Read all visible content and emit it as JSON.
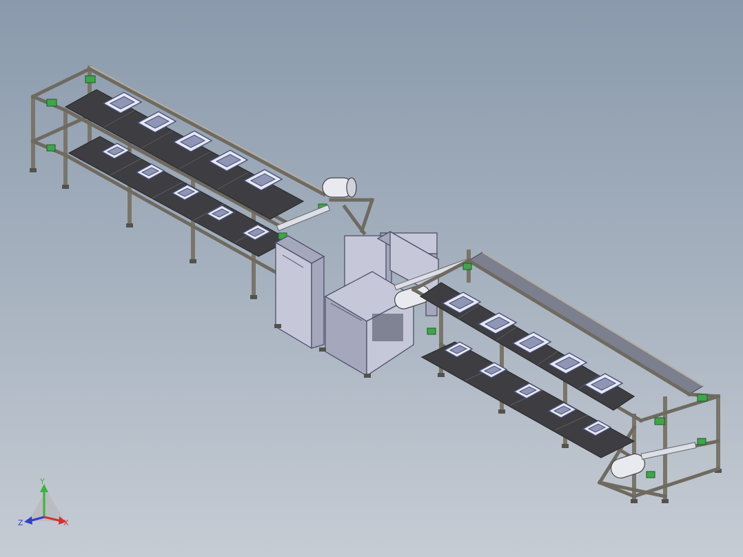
{
  "viewport": {
    "background_top": "#8a9aac",
    "background_bottom": "#c6ccd4"
  },
  "triad": {
    "x_label": "X",
    "y_label": "Y",
    "z_label": "Z",
    "x_color": "#d62f2f",
    "y_color": "#3bb43b",
    "z_color": "#3140c8"
  }
}
